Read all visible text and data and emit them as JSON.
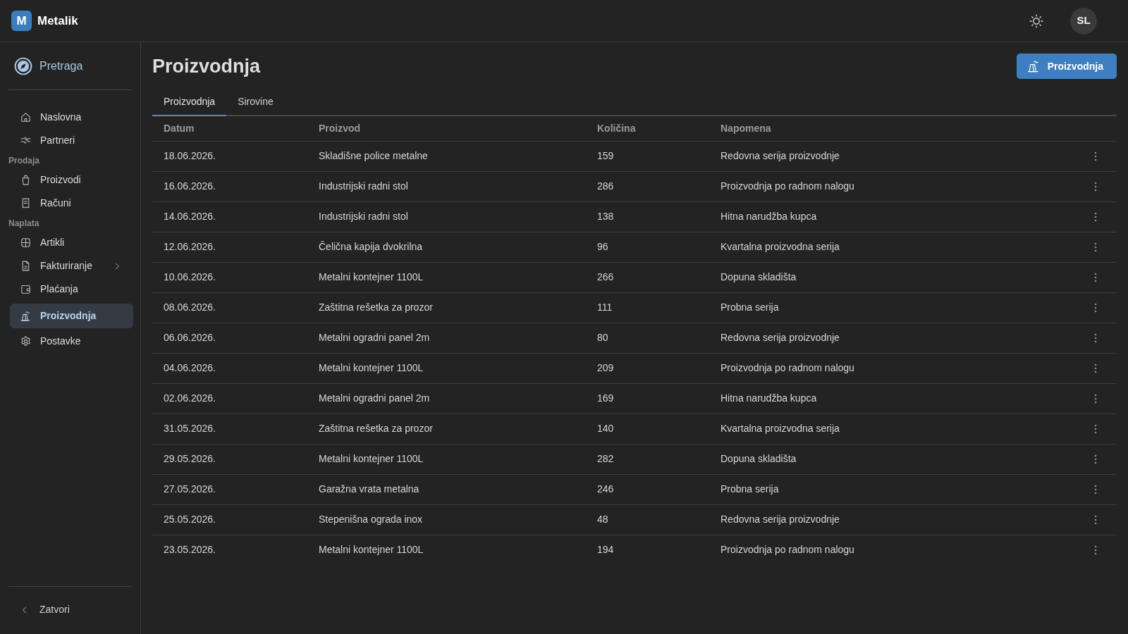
{
  "header": {
    "logo_letter": "M",
    "app_name": "Metalik",
    "avatar_initials": "SL"
  },
  "sidebar": {
    "search_label": "Pretraga",
    "groups": [
      {
        "items": [
          {
            "label": "Naslovna",
            "kind": "link",
            "selected": false
          },
          {
            "label": "Partneri",
            "kind": "link",
            "selected": false
          }
        ]
      },
      {
        "title": "Prodaja",
        "items": [
          {
            "label": "Proizvodi",
            "kind": "link",
            "selected": false
          },
          {
            "label": "Računi",
            "kind": "link",
            "selected": false
          }
        ]
      },
      {
        "title": "Naplata",
        "items": [
          {
            "label": "Artikli",
            "kind": "link",
            "selected": false
          },
          {
            "label": "Fakturiranje",
            "kind": "submenu",
            "selected": false
          },
          {
            "label": "Plaćanja",
            "kind": "link",
            "selected": false
          },
          {
            "label": "Proizvodnja",
            "kind": "link",
            "selected": true
          },
          {
            "label": "Postavke",
            "kind": "link",
            "selected": false
          }
        ]
      }
    ],
    "collapse_label": "Zatvori"
  },
  "page": {
    "title": "Proizvodnja",
    "action_button": "Proizvodnja",
    "tabs": [
      {
        "label": "Proizvodnja",
        "selected": true
      },
      {
        "label": "Sirovine",
        "selected": false
      }
    ],
    "table": {
      "columns": [
        "Datum",
        "Proizvod",
        "Količina",
        "Napomena"
      ],
      "rows": [
        [
          "18.06.2026.",
          "Skladišne police metalne",
          "159",
          "Redovna serija proizvodnje"
        ],
        [
          "16.06.2026.",
          "Industrijski radni stol",
          "286",
          "Proizvodnja po radnom nalogu"
        ],
        [
          "14.06.2026.",
          "Industrijski radni stol",
          "138",
          "Hitna narudžba kupca"
        ],
        [
          "12.06.2026.",
          "Čelična kapija dvokrilna",
          "96",
          "Kvartalna proizvodna serija"
        ],
        [
          "10.06.2026.",
          "Metalni kontejner 1100L",
          "266",
          "Dopuna skladišta"
        ],
        [
          "08.06.2026.",
          "Zaštitna rešetka za prozor",
          "111",
          "Probna serija"
        ],
        [
          "06.06.2026.",
          "Metalni ogradni panel 2m",
          "80",
          "Redovna serija proizvodnje"
        ],
        [
          "04.06.2026.",
          "Metalni kontejner 1100L",
          "209",
          "Proizvodnja po radnom nalogu"
        ],
        [
          "02.06.2026.",
          "Metalni ogradni panel 2m",
          "169",
          "Hitna narudžba kupca"
        ],
        [
          "31.05.2026.",
          "Zaštitna rešetka za prozor",
          "140",
          "Kvartalna proizvodna serija"
        ],
        [
          "29.05.2026.",
          "Metalni kontejner 1100L",
          "282",
          "Dopuna skladišta"
        ],
        [
          "27.05.2026.",
          "Garažna vrata metalna",
          "246",
          "Probna serija"
        ],
        [
          "25.05.2026.",
          "Stepenišna ograda inox",
          "48",
          "Redovna serija proizvodnje"
        ],
        [
          "23.05.2026.",
          "Metalni kontejner 1100L",
          "194",
          "Proizvodnja po radnom nalogu"
        ]
      ]
    }
  }
}
